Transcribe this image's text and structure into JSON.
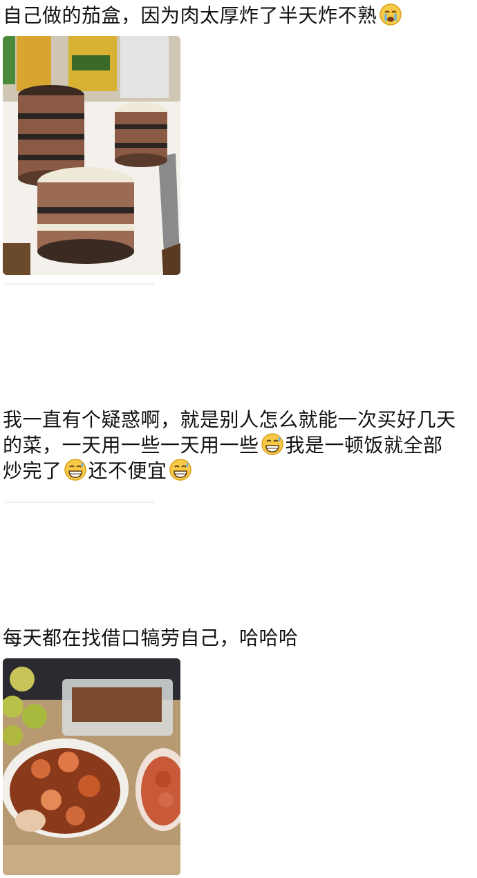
{
  "posts": [
    {
      "text_parts": [
        "自己做的茄盒，因为肉太厚炸了半天炸不熟"
      ],
      "trailing_emoji": "crying-face-icon"
    },
    {
      "text_parts": [
        "我一直有个疑惑啊，就是别人怎么就能一次买好几天的菜，一天用一些一天用一些",
        "我是一顿饭就全部炒完了",
        "还不便宜"
      ],
      "emojis": [
        "sweat-grin-icon",
        "sweat-grin-icon",
        "sweat-grin-icon"
      ]
    },
    {
      "text_parts": [
        "每天都在找借口犒劳自己，哈哈哈"
      ]
    }
  ],
  "photos": [
    {
      "subject": "eggplant-meat-sandwich-photo"
    },
    {
      "subject": "shrimp-stir-fry-photo"
    }
  ],
  "colors": {
    "text": "#111111",
    "background": "#ffffff",
    "emoji_face": "#f7c948"
  }
}
